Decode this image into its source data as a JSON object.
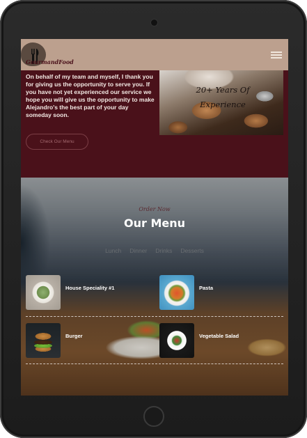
{
  "brand": {
    "name": "GourmandFood",
    "accent": "#4a111a",
    "header_bg": "#bca08e"
  },
  "header": {
    "logo_icon": "fork-knife-icon",
    "menu_icon": "hamburger-menu-icon"
  },
  "about": {
    "text": "On behalf of my team and myself, I thank you for giving us the opportunity to serve you. If you have not yet experienced our service we hope you will give us the opportunity to make Alejandro's the best part of your day someday soon.",
    "button_label": "Check Our Menu",
    "experience_label": "20+ Years Of Experience"
  },
  "menu": {
    "kicker": "Order Now",
    "title": "Our Menu",
    "tabs": [
      {
        "label": "Lunch"
      },
      {
        "label": "Dinner"
      },
      {
        "label": "Drinks"
      },
      {
        "label": "Desserts"
      }
    ],
    "items": [
      {
        "name": "House Speciality #1"
      },
      {
        "name": "Pasta"
      },
      {
        "name": "Burger"
      },
      {
        "name": "Vegetable Salad"
      }
    ]
  }
}
